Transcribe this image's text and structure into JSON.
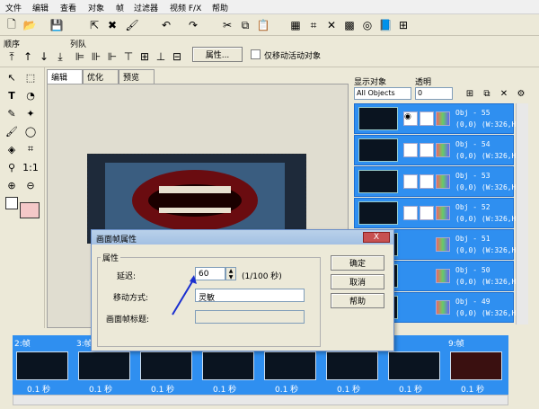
{
  "menu": [
    "文件",
    "编辑",
    "查看",
    "对象",
    "帧",
    "过滤器",
    "视频 F/X",
    "帮助"
  ],
  "toolbar2": {
    "order_label": "顺序",
    "queue_label": "列队",
    "properties_button": "属性...",
    "move_only_label": "仅移动活动对象"
  },
  "tabs": [
    "编辑",
    "优化",
    "预览"
  ],
  "right_panel": {
    "show_objects_label": "显示对象",
    "transparency_label": "透明",
    "objects_select": "All Objects",
    "transparency_value": "0",
    "objects": [
      {
        "name": "Obj - 55",
        "info": "(0,0) (W:326,H:"
      },
      {
        "name": "Obj - 54",
        "info": "(0,0) (W:326,H:"
      },
      {
        "name": "Obj - 53",
        "info": "(0,0) (W:326,H:"
      },
      {
        "name": "Obj - 52",
        "info": "(0,0) (W:326,H:"
      },
      {
        "name": "Obj - 51",
        "info": "(0,0) (W:326,H:"
      },
      {
        "name": "Obj - 50",
        "info": "(0,0) (W:326,H:"
      },
      {
        "name": "Obj - 49",
        "info": "(0,0) (W:326,H:"
      }
    ]
  },
  "frames": [
    {
      "label": "2:帧",
      "time": "0.1 秒"
    },
    {
      "label": "3:帧",
      "time": "0.1 秒"
    },
    {
      "label": "",
      "time": "0.1 秒"
    },
    {
      "label": "",
      "time": "0.1 秒"
    },
    {
      "label": "",
      "time": "0.1 秒"
    },
    {
      "label": "",
      "time": "0.1 秒"
    },
    {
      "label": "",
      "time": "0.1 秒"
    },
    {
      "label": "9:帧",
      "time": "0.1 秒"
    }
  ],
  "dialog": {
    "title": "画面帧属性",
    "close": "X",
    "group_label": "属性",
    "delay_label": "延迟:",
    "delay_value": "60",
    "delay_unit": "(1/100 秒)",
    "move_mode_label": "移动方式:",
    "move_mode_value": "灵敏",
    "frame_title_label": "画面帧标题:",
    "ok": "确定",
    "cancel": "取消",
    "help": "帮助"
  },
  "colors": {
    "selection": "#2f8ff0",
    "canvas_bg": "#e0ddd0"
  }
}
